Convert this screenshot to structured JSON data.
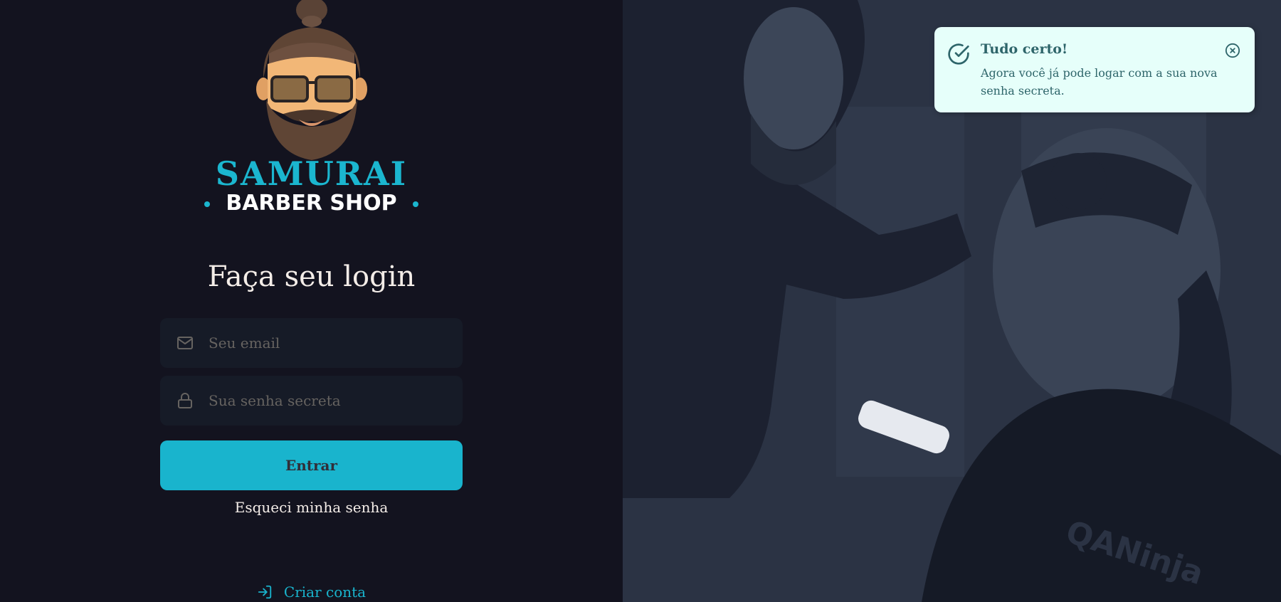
{
  "brand": {
    "name": "SAMURAI",
    "subtitle": "BARBER SHOP",
    "accent_color": "#1bb6cf"
  },
  "login": {
    "title": "Faça seu login",
    "email_placeholder": "Seu email",
    "email_value": "",
    "password_placeholder": "Sua senha secreta",
    "password_value": "",
    "submit_label": "Entrar",
    "forgot_label": "Esqueci minha senha",
    "create_label": "Criar conta",
    "email_icon": "mail-icon",
    "password_icon": "lock-icon",
    "create_icon": "log-in-icon"
  },
  "toast": {
    "type": "success",
    "title": "Tudo certo!",
    "description": "Agora você já pode logar com a sua nova senha secreta.",
    "icon": "check-circle-icon",
    "close_icon": "close-circle-icon",
    "background": "#e6fffa",
    "text_color": "#2e656a"
  },
  "photo": {
    "watermark": "QANinja"
  }
}
